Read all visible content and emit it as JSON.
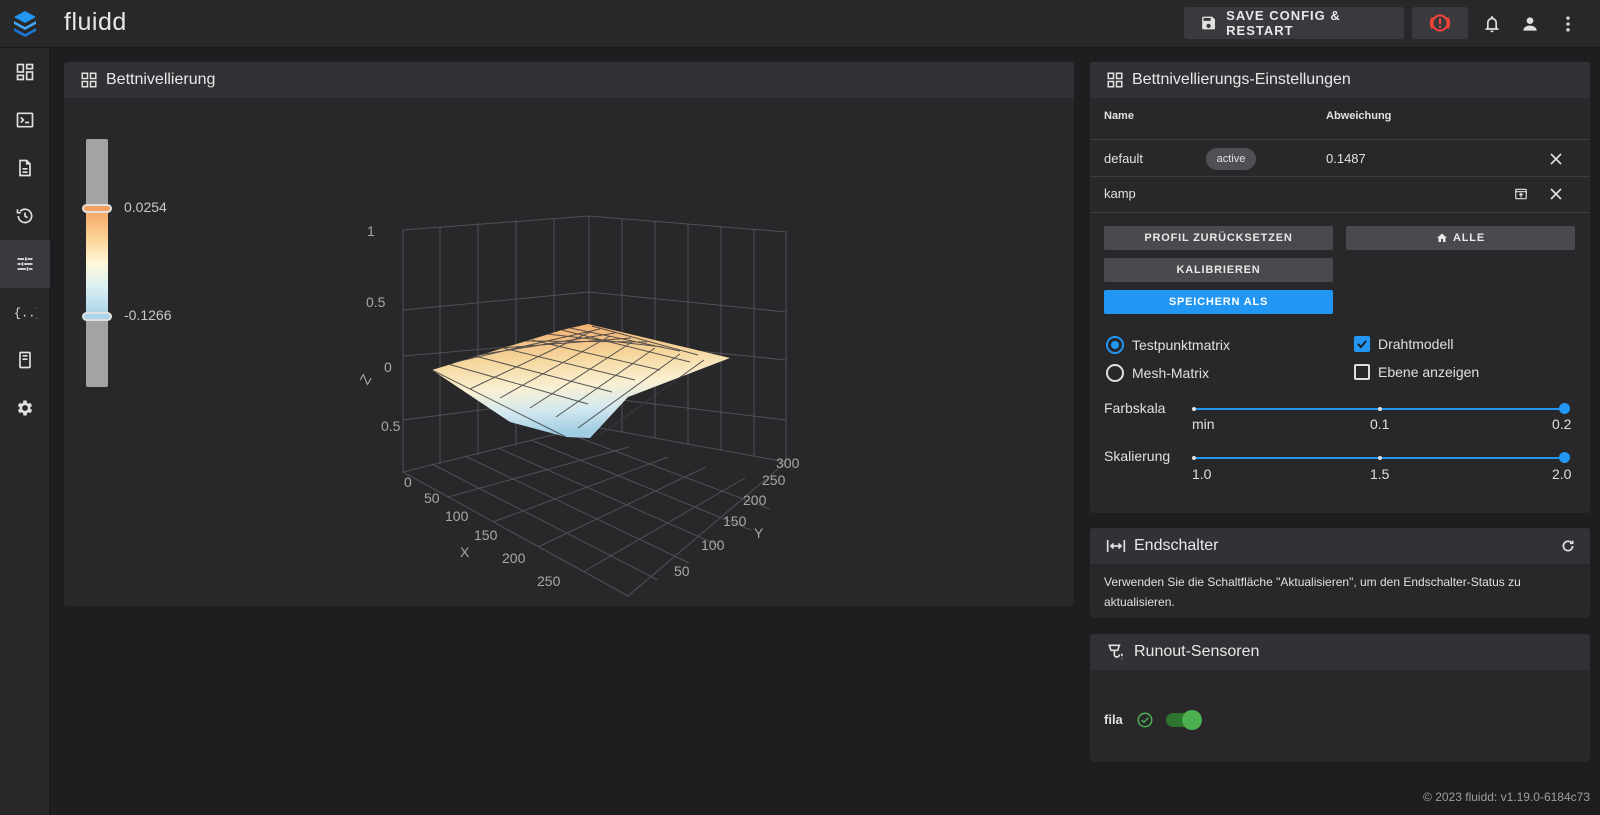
{
  "app": {
    "title": "fluidd"
  },
  "toolbar": {
    "save_restart_label": "SAVE CONFIG & RESTART"
  },
  "sidebar": {
    "items": [
      "dashboard",
      "console",
      "jobs",
      "history",
      "tune",
      "configuration",
      "system",
      "settings"
    ],
    "active": "tune"
  },
  "bed_mesh": {
    "title": "Bettnivellierung",
    "legend": {
      "max_label": "0.0254",
      "min_label": "-0.1266"
    },
    "chart": {
      "axes": {
        "z_label": "Z",
        "x_label": "X",
        "y_label": "Y",
        "z_ticks": [
          "1",
          "0.5",
          "0",
          "0.5",
          "0"
        ],
        "x_ticks": [
          "50",
          "100",
          "150",
          "200",
          "250"
        ],
        "y_ticks": [
          "300",
          "250",
          "200",
          "150",
          "100",
          "50"
        ]
      }
    }
  },
  "chart_data": {
    "type": "surface",
    "title": "",
    "xlabel": "X",
    "ylabel": "Y",
    "zlabel": "Z",
    "color_range": {
      "min": -0.1266,
      "max": 0.0254
    },
    "grid": true
  },
  "settings": {
    "title": "Bettnivellierungs-Einstellungen",
    "columns": {
      "name": "Name",
      "deviation": "Abweichung"
    },
    "profiles": [
      {
        "name": "default",
        "badge": "active",
        "deviation": "0.1487"
      },
      {
        "name": "kamp",
        "badge": "",
        "deviation": ""
      }
    ],
    "buttons": {
      "reset": "PROFIL ZURÜCKSETZEN",
      "home_all": "ALLE",
      "calibrate": "KALIBRIEREN",
      "save_as": "SPEICHERN ALS"
    },
    "options": {
      "probed_matrix": "Testpunktmatrix",
      "mesh_matrix": "Mesh-Matrix",
      "wireframe": "Drahtmodell",
      "show_plane": "Ebene anzeigen",
      "selected_matrix": "Testpunktmatrix",
      "wireframe_checked": true,
      "show_plane_checked": false
    },
    "color_scale": {
      "label": "Farbskala",
      "ticks": [
        "min",
        "0.1",
        "0.2"
      ],
      "value": 0.2
    },
    "scale": {
      "label": "Skalierung",
      "ticks": [
        "1.0",
        "1.5",
        "2.0"
      ],
      "value": 2.0
    }
  },
  "endstops": {
    "title": "Endschalter",
    "message": "Verwenden Sie die Schaltfläche \"Aktualisieren\", um den Endschalter-Status zu aktualisieren."
  },
  "runout": {
    "title": "Runout-Sensoren",
    "sensors": [
      {
        "name": "fila",
        "enabled": true
      }
    ]
  },
  "footer": {
    "text": "© 2023 fluidd: v1.19.0-6184c73"
  },
  "colors": {
    "accent": "#2196f3",
    "surface_high": "#f6a060",
    "surface_low": "#a9d4e9",
    "ok": "#4caf50",
    "estop": "#f44336"
  }
}
